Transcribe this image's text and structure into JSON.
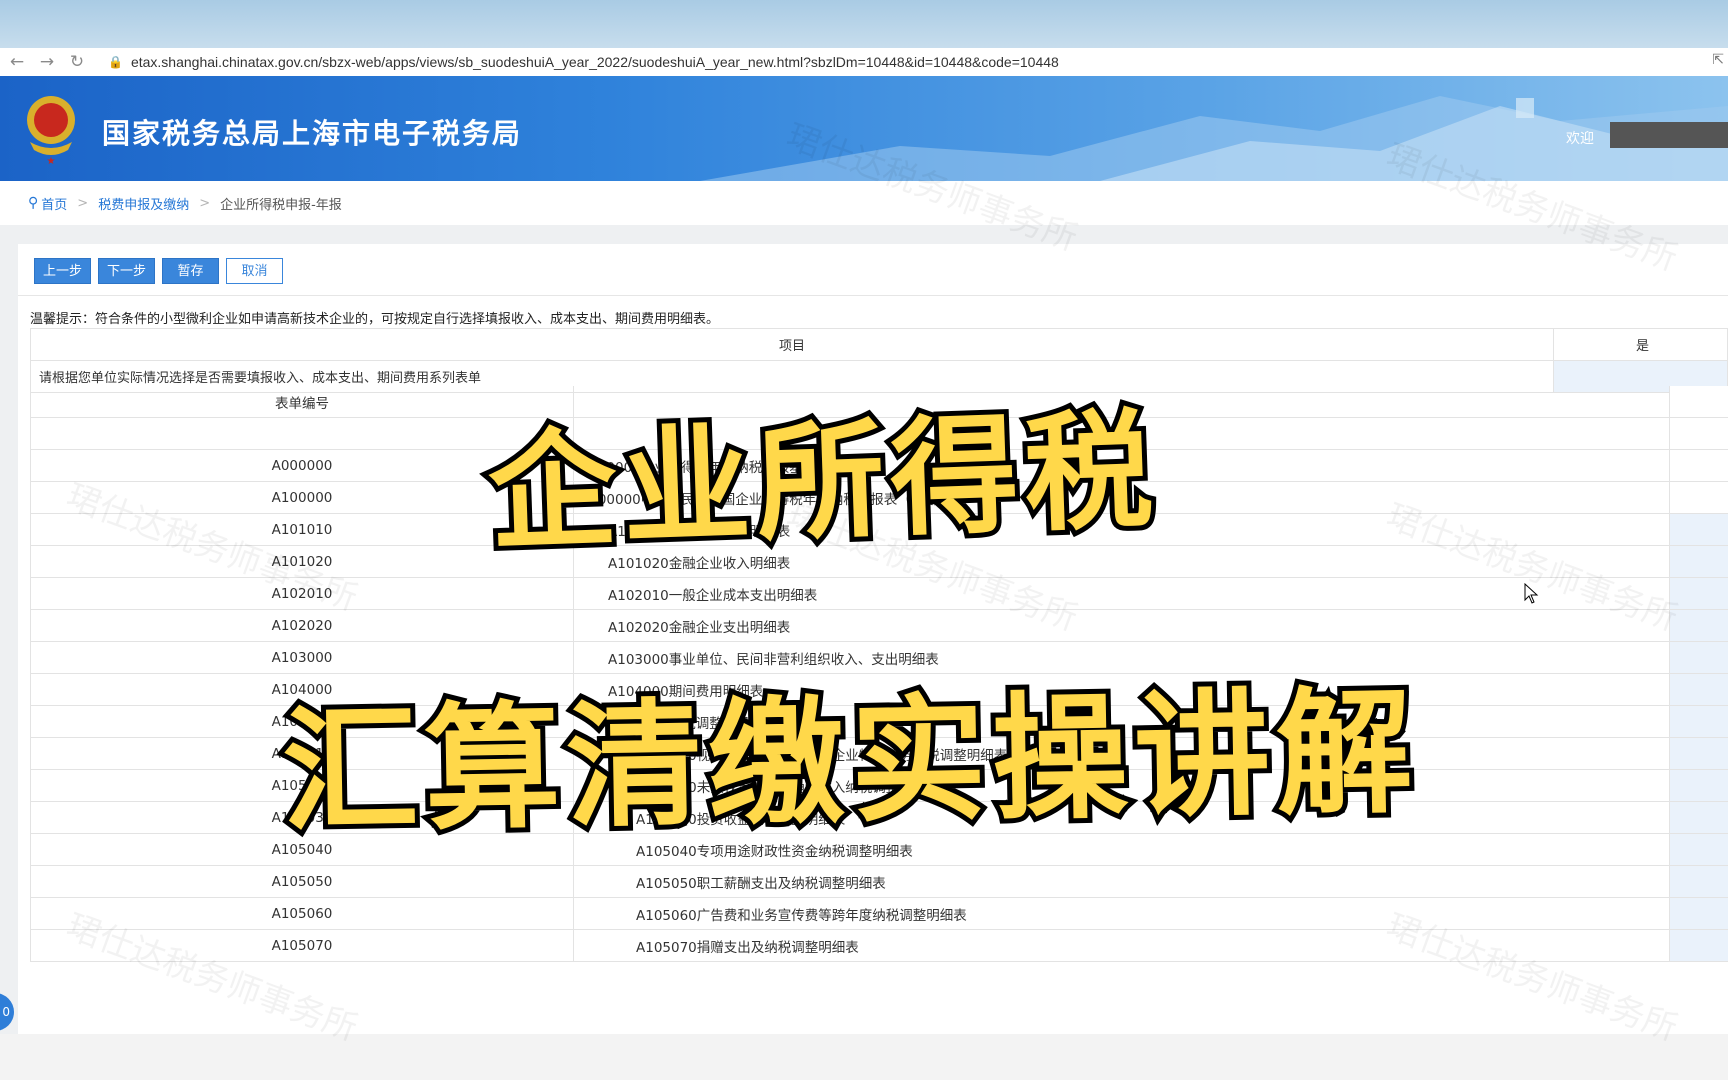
{
  "browser": {
    "url": "etax.shanghai.chinatax.gov.cn/sbzx-web/apps/views/sb_suodeshuiA_year_2022/suodeshuiA_year_new.html?sbzlDm=10448&id=10448&code=10448"
  },
  "header": {
    "title": "国家税务总局上海市电子税务局",
    "welcome": "欢迎"
  },
  "breadcrumb": {
    "home": "首页",
    "level1": "税费申报及缴纳",
    "current": "企业所得税申报-年报"
  },
  "toolbar": {
    "prev": "上一步",
    "next": "下一步",
    "save": "暂存",
    "cancel": "取消"
  },
  "hint": "温馨提示：符合条件的小型微利企业如申请高新技术企业的，可按规定自行选择填报收入、成本支出、期间费用明细表。",
  "project_table": {
    "col1": "项目",
    "col2": "是",
    "row1": "请根据您单位实际情况选择是否需要填报收入、成本支出、期间费用系列表单"
  },
  "forms_table": {
    "header_code": "表单编号",
    "rows": [
      {
        "code": "A000000",
        "name": "A000000企业所得税年度纳税申报基础信息表"
      },
      {
        "code": "A100000",
        "name": "A100000中华人民共和国企业所得税年度纳税申报表（A类）"
      },
      {
        "code": "A101010",
        "name": "A101010一般企业收入明细表"
      },
      {
        "code": "A101020",
        "name": "A101020金融企业收入明细表"
      },
      {
        "code": "A102010",
        "name": "A102010一般企业成本支出明细表"
      },
      {
        "code": "A102020",
        "name": "A102020金融企业支出明细表"
      },
      {
        "code": "A103000",
        "name": "A103000事业单位、民间非营利组织收入、支出明细表"
      },
      {
        "code": "A104000",
        "name": "A104000期间费用明细表"
      },
      {
        "code": "A105000",
        "name": "A105000纳税调整项目明细表"
      },
      {
        "code": "A105010",
        "name": "A105010视同销售和房地产开发企业特定业务纳税调整明细表"
      },
      {
        "code": "A105020",
        "name": "A105020未按权责发生制确认收入纳税调整明细表"
      },
      {
        "code": "A105030",
        "name": "A105030投资收益纳税调整明细表"
      },
      {
        "code": "A105040",
        "name": "A105040专项用途财政性资金纳税调整明细表"
      },
      {
        "code": "A105050",
        "name": "A105050职工薪酬支出及纳税调整明细表"
      },
      {
        "code": "A105060",
        "name": "A105060广告费和业务宣传费等跨年度纳税调整明细表"
      },
      {
        "code": "A105070",
        "name": "A105070捐赠支出及纳税调整明细表"
      }
    ]
  },
  "overlay": {
    "line1": "企业所得税",
    "line2": "汇算清缴实操讲解"
  },
  "watermark": "珺仕达税务师事务所",
  "side_badge": "0",
  "colors": {
    "primary": "#3a86db",
    "overlay_text": "#ffd84a"
  }
}
